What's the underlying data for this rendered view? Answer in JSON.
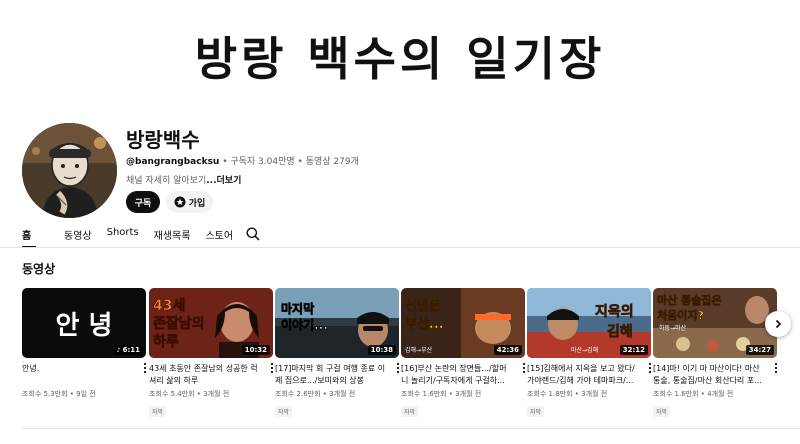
{
  "banner": {
    "text": "방랑 백수의 일기장"
  },
  "channel": {
    "name": "방랑백수",
    "handle": "@bangrangbacksu",
    "stats": " • 구독자 3.04만명 • 동영상 279개",
    "description": "채널 자세히 알아보기",
    "more_label": "...더보기",
    "subscribe_label": "구독",
    "join_label": "가입"
  },
  "tabs": [
    {
      "label": "홈",
      "active": true
    },
    {
      "label": "동영상",
      "active": false
    },
    {
      "label": "Shorts",
      "active": false
    },
    {
      "label": "재생목록",
      "active": false
    },
    {
      "label": "스토어",
      "active": false
    }
  ],
  "section": {
    "title": "동영상"
  },
  "videos": [
    {
      "thumb_text": "안 녕",
      "duration": "6:11",
      "title": "안녕.",
      "meta": "조회수 5.3만회 • 9일 전",
      "badge": ""
    },
    {
      "thumb_text": "43세 존잘남의 하루",
      "duration": "10:32",
      "title": "43세 초동안 존잘남의 성공한 럭셔리 삶의 하루",
      "meta": "조회수 5.4만회 • 3개월 전",
      "badge": "자막"
    },
    {
      "thumb_text": "마지막 이야기...",
      "duration": "10:38",
      "title": "[17]마지막 회 구걸 여행 종료 이제 집으로.../보미와의 상봉",
      "meta": "조회수 2.6만회 • 3개월 전",
      "badge": "자막"
    },
    {
      "thumb_text": "선넘은 부산...",
      "duration": "42:36",
      "title": "[16]부산 논란의 장면들.../할머니 놀리기/구독자에게 구걸하...",
      "meta": "조회수 1.6만회 • 3개월 전",
      "badge": "자막"
    },
    {
      "thumb_text": "지옥의 김해",
      "duration": "32:12",
      "title": "[15]김해에서 지옥을 보고 왔다/가야랜드/김해 가야 테마파크/...",
      "meta": "조회수 1.8만회 • 3개월 전",
      "badge": "자막"
    },
    {
      "thumb_text": "마산 통술집은 처음이지?",
      "duration": "34:27",
      "title": "[14]마! 이기 마 마산이다! 마산 통술, 통술집/마산 회산다리 포...",
      "meta": "조회수 1.6만회 • 4개월 전",
      "badge": "자막"
    }
  ],
  "colors": {
    "accent": "#0f0f0f",
    "meta": "#606060",
    "chip": "#f2f2f2"
  }
}
